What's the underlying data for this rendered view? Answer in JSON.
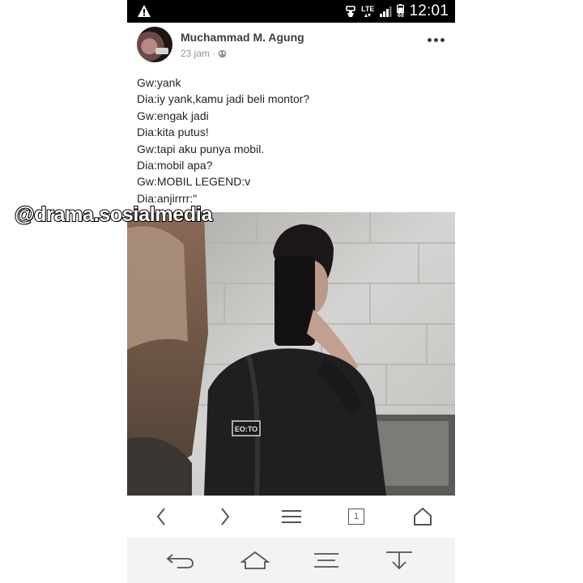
{
  "status_bar": {
    "network": "LTE",
    "battery_level": "68",
    "time": "12:01",
    "icons": [
      "alert-triangle-icon",
      "data-saver-icon",
      "signal-icon",
      "battery-icon"
    ]
  },
  "post": {
    "author": "Muchammad M. Agung",
    "timestamp": "23 jam",
    "separator": "·",
    "privacy_icon": "globe-icon",
    "lines": [
      "Gw:yank",
      "Dia:iy yank,kamu jadi beli montor?",
      "Gw:engak jadi",
      "Dia:kita putus!",
      "Gw:tapi aku punya mobil.",
      "Dia:mobil apa?",
      "Gw:MOBIL LEGEND:v",
      "Dia:anjirrrr:\""
    ],
    "shirt_text": "EO:TO"
  },
  "watermark": "@drama.sosialmedia",
  "browser_nav": {
    "tab_count": "1",
    "icons": [
      "back-chevron-icon",
      "forward-chevron-icon",
      "menu-icon",
      "tabs-icon",
      "home-icon"
    ]
  },
  "system_nav": {
    "icons": [
      "back-icon",
      "home-outline-icon",
      "menu-lines-icon",
      "download-icon"
    ]
  },
  "colors": {
    "author": "#3b3e45",
    "meta": "#90949c",
    "text": "#1d2129",
    "status_bar": "#000000",
    "system_bar": "#f3f3f3"
  }
}
